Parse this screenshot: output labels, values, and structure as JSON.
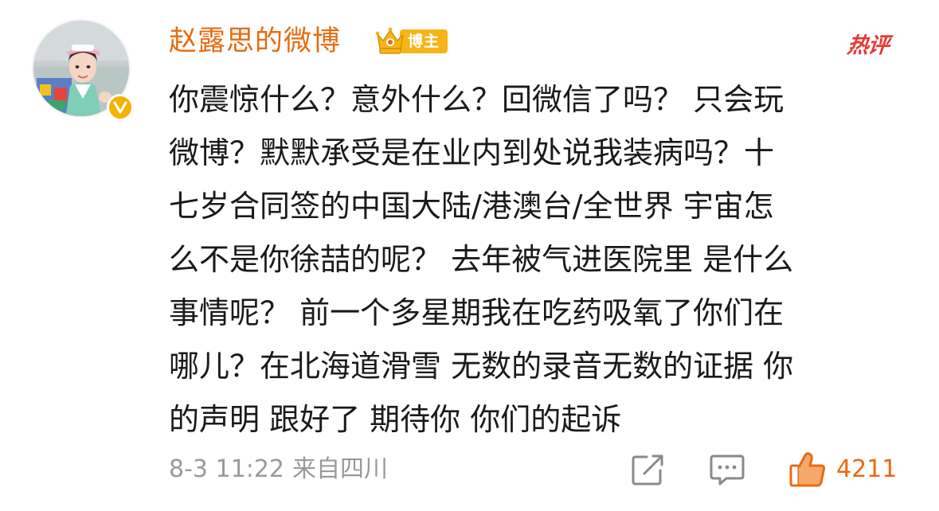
{
  "post": {
    "username": "赵露思的微博",
    "badge_label": "博主",
    "hot_label": "热评",
    "content_lines": [
      "你震惊什么？意外什么？回微信了吗？ 只会玩",
      "微博？默默承受是在业内到处说我装病吗？十",
      "七岁合同签的中国大陆/港澳台/全世界  宇宙怎",
      "么不是你徐喆的呢？  去年被气进医院里 是什么",
      "事情呢？  前一个多星期我在吃药吸氧了你们在",
      "哪儿？在北海道滑雪 无数的录音无数的证据 你",
      "的声明 跟好了 期待你 你们的起诉"
    ],
    "timestamp": "8-3 11:22",
    "location": "来自四川",
    "like_count": "4211"
  },
  "icons": {
    "avatar": "avatar-photo",
    "verified": "verified-v-icon",
    "crown": "crown-badge-icon",
    "share": "share-edit-icon",
    "comment": "comment-icon",
    "like": "thumbs-up-icon"
  },
  "colors": {
    "username": "#e86b10",
    "badge": "#f6b417",
    "hot": "#e53a36",
    "like": "#e86b10",
    "meta": "#9a9a9a",
    "text": "#1a1a1a"
  }
}
